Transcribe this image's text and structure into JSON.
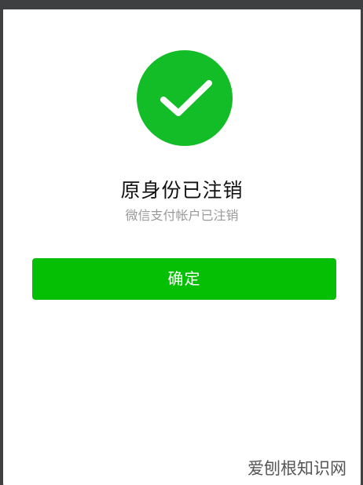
{
  "status": {
    "icon": "check-icon",
    "accent_color": "#13bd27"
  },
  "message": {
    "title": "原身份已注销",
    "subtitle": "微信支付帐户已注销"
  },
  "actions": {
    "confirm_label": "确定"
  },
  "watermark": {
    "text": "爱刨根知识网"
  }
}
